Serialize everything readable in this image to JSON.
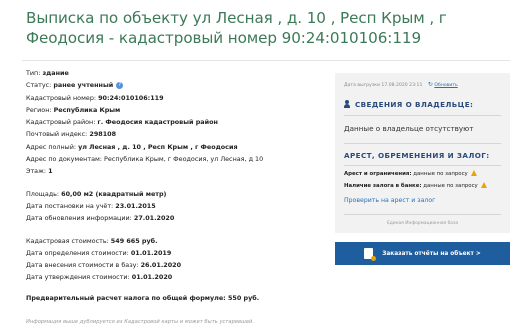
{
  "header": {
    "title": "Выписка по объекту ул Лесная , д. 10 , Респ Крым , г Феодосия - кадастровый номер 90:24:010106:119"
  },
  "details": {
    "type_label": "Тип:",
    "type_value": "здание",
    "status_label": "Статус:",
    "status_value": "ранее учтенный",
    "cadnum_label": "Кадастровый номер:",
    "cadnum_value": "90:24:010106:119",
    "region_label": "Регион:",
    "region_value": "Республика Крым",
    "district_label": "Кадастровый район:",
    "district_value": "г. Феодосия кадастровый район",
    "postal_label": "Почтовый индекс:",
    "postal_value": "298108",
    "addr_full_label": "Адрес полный:",
    "addr_full_value": "ул Лесная , д. 10 , Респ Крым , г Феодосия",
    "addr_doc_label": "Адрес по документам:",
    "addr_doc_value": "Республика Крым, г Феодосия, ул Лесная, д 10",
    "floor_label": "Этаж:",
    "floor_value": "1",
    "area_label": "Площадь:",
    "area_value": "60,00 м2 (квадратный метр)",
    "reg_date_label": "Дата постановки на учёт:",
    "reg_date_value": "23.01.2015",
    "upd_date_label": "Дата обновления информации:",
    "upd_date_value": "27.01.2020",
    "cad_cost_label": "Кадастровая стоимость:",
    "cad_cost_value": "549 665 руб.",
    "cost_def_label": "Дата определения стоимости:",
    "cost_def_value": "01.01.2019",
    "cost_entry_label": "Дата внесения стоимости в базу:",
    "cost_entry_value": "26.01.2020",
    "cost_appr_label": "Дата утверждения стоимости:",
    "cost_appr_value": "01.01.2020",
    "tax_text": "Предварительный расчет налога по общей формуле: 550 руб."
  },
  "footnote": "Информация выше дублируется из Кадастровой карты и может быть устаревшей.",
  "panel": {
    "export_date": "Дата выгрузки 17.08.2020 23:11",
    "refresh_label": "Обновить",
    "owner_heading": "СВЕДЕНИЯ О ВЛАДЕЛЬЦЕ:",
    "owner_text": "Данные о владельце отсутствуют",
    "enc_heading": "АРЕСТ, ОБРЕМЕНЕНИЯ И ЗАЛОГ:",
    "arrest_label": "Арест и ограничения:",
    "arrest_value": "данные по запросу",
    "pledge_label": "Наличие залога в банке:",
    "pledge_value": "данные по запросу",
    "check_link": "Проверить на арест и залог",
    "base_caption": "Единая Информационная база"
  },
  "cta": {
    "label": "Заказать отчёты на объект >"
  },
  "colors": {
    "title_green": "#3c7a58",
    "link_blue": "#2b6fb5",
    "cta_blue": "#1f5e9e",
    "warning": "#e8a400"
  }
}
